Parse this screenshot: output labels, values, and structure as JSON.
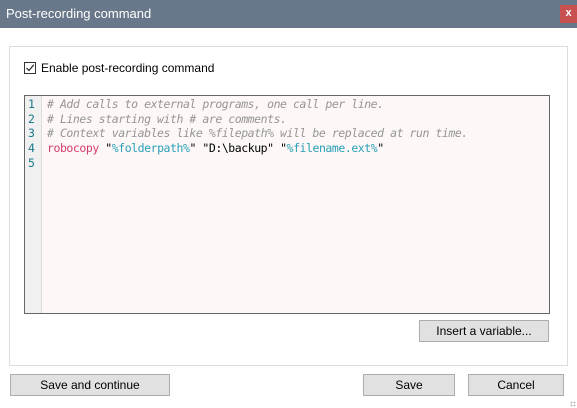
{
  "window": {
    "title": "Post-recording command",
    "close_label": "x"
  },
  "options": {
    "enable_label": "Enable post-recording command",
    "enable_checked": true
  },
  "editor": {
    "line_numbers": [
      "1",
      "2",
      "3",
      "4",
      "5"
    ],
    "lines": [
      {
        "comment": "# Add calls to external programs, one call per line."
      },
      {
        "comment": "# Lines starting with # are comments."
      },
      {
        "comment": "# Context variables like %filepath% will be replaced at run time."
      },
      {
        "command": "robocopy",
        "q1": "\"",
        "arg1": "%folderpath%",
        "q2": "\"",
        "mid": " \"D:\\backup\" ",
        "q3": "\"",
        "arg3": "%filename.ext%",
        "q4": "\""
      }
    ]
  },
  "buttons": {
    "insert_variable": "Insert a variable...",
    "save_continue": "Save and continue",
    "save": "Save",
    "cancel": "Cancel"
  }
}
